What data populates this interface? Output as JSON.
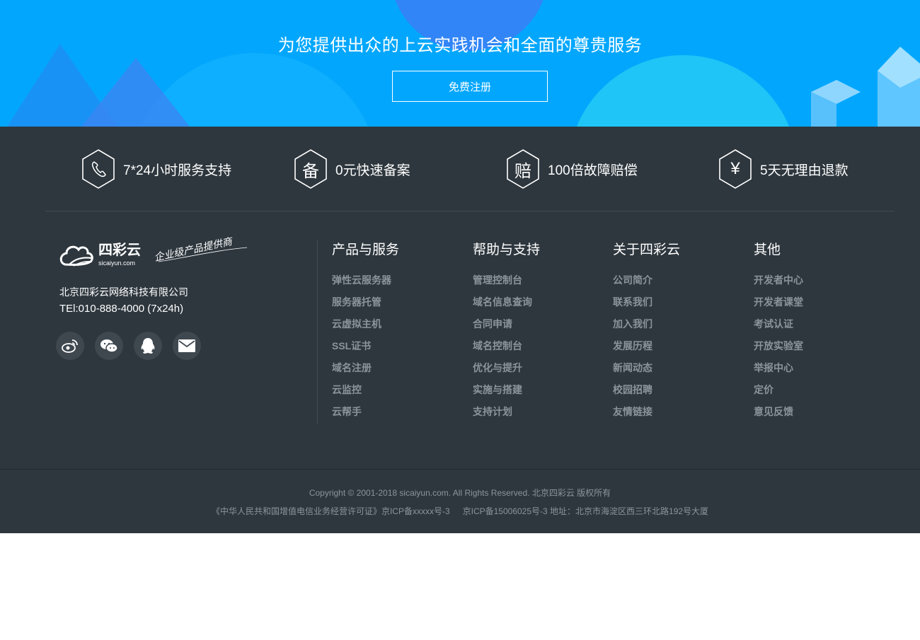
{
  "banner": {
    "title": "为您提供出众的上云实践机会和全面的尊贵服务",
    "register_label": "免费注册"
  },
  "features": [
    {
      "icon": "phone-icon",
      "glyph": "",
      "label": "7*24小时服务支持"
    },
    {
      "icon": "filing-icon",
      "glyph": "备",
      "label": "0元快速备案"
    },
    {
      "icon": "compensation-icon",
      "glyph": "赔",
      "label": "100倍故障赔偿"
    },
    {
      "icon": "yuan-icon",
      "glyph": "¥",
      "label": "5天无理由退款"
    }
  ],
  "brand": {
    "name": "四彩云",
    "domain": "sicaiyun.com",
    "slogan": "企业级产品提供商",
    "company": "北京四彩云网络科技有限公司",
    "tel": "TEl:010-888-4000 (7x24h)"
  },
  "social": [
    "weibo-icon",
    "wechat-icon",
    "qq-icon",
    "mail-icon"
  ],
  "columns": [
    {
      "title": "产品与服务",
      "items": [
        "弹性云服务器",
        "服务器托管",
        "云虚拟主机",
        "SSL证书",
        "域名注册",
        "云监控",
        "云帮手"
      ]
    },
    {
      "title": "帮助与支持",
      "items": [
        "管理控制台",
        "域名信息查询",
        "合同申请",
        "域名控制台",
        "优化与提升",
        "实施与搭建",
        "支持计划"
      ]
    },
    {
      "title": "关于四彩云",
      "items": [
        "公司简介",
        "联系我们",
        "加入我们",
        "发展历程",
        "新闻动态",
        "校园招聘",
        "友情链接"
      ]
    },
    {
      "title": "其他",
      "items": [
        "开发者中心",
        "开发者课堂",
        "考试认证",
        "开放实验室",
        "举报中心",
        "定价",
        "意见反馈"
      ]
    }
  ],
  "footer": {
    "copyright": "Copyright © 2001-2018 sicaiyun.com. All Rights Reserved. 北京四彩云 版权所有",
    "license": "《中华人民共和国增值电信业务经营许可证》京ICP备xxxxx号-3",
    "icp_address": "京ICP备15006025号-3 地址：北京市海淀区西三环北路192号大厦"
  },
  "colors": {
    "banner_bg": "#02a7fd",
    "footer_bg": "#2e373e",
    "link": "#8b949b"
  }
}
